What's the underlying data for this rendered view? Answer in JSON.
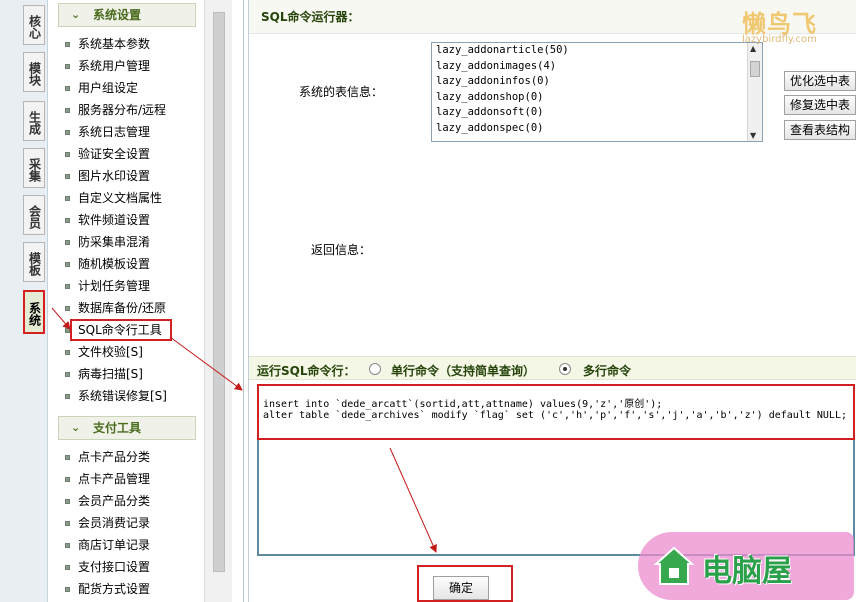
{
  "side_tabs": [
    {
      "label": "核心"
    },
    {
      "label": "模块"
    },
    {
      "label": "生成"
    },
    {
      "label": "采集"
    },
    {
      "label": "会员"
    },
    {
      "label": "模板"
    },
    {
      "label": "系统"
    }
  ],
  "menu": {
    "section1_title": "系统设置",
    "section1_items": [
      "系统基本参数",
      "系统用户管理",
      "用户组设定",
      "服务器分布/远程",
      "系统日志管理",
      "验证安全设置",
      "图片水印设置",
      "自定义文档属性",
      "软件频道设置",
      "防采集串混淆",
      "随机模板设置",
      "计划任务管理",
      "数据库备份/还原",
      "SQL命令行工具",
      "文件校验[S]",
      "病毒扫描[S]",
      "系统错误修复[S]"
    ],
    "section2_title": "支付工具",
    "section2_items": [
      "点卡产品分类",
      "点卡产品管理",
      "会员产品分类",
      "会员消费记录",
      "商店订单记录",
      "支付接口设置",
      "配货方式设置"
    ]
  },
  "main": {
    "title": "SQL命令运行器：",
    "tables_label": "系统的表信息：",
    "tables": [
      "lazy_addonarticle(50)",
      "lazy_addonimages(4)",
      "lazy_addoninfos(0)",
      "lazy_addonshop(0)",
      "lazy_addonsoft(0)",
      "lazy_addonspec(0)"
    ],
    "btn_optimize": "优化选中表",
    "btn_repair": "修复选中表",
    "btn_structure": "查看表结构",
    "return_label": "返回信息：",
    "run_label": "运行SQL命令行：",
    "opt_single": "单行命令（支持简单查询）",
    "opt_multi": "多行命令",
    "selected_mode": "multi",
    "sql_lines": [
      "insert into `dede_arcatt`(sortid,att,attname) values(9,'z','原创');",
      "alter table `dede_archives` modify `flag` set ('c','h','p','f','s','j','a','b','z') default NULL;"
    ],
    "ok_button": "确定"
  },
  "watermark": {
    "top_brand": "懒鸟飞",
    "top_url": "lazybirdfly.com",
    "bottom_brand": "电脑屋"
  }
}
